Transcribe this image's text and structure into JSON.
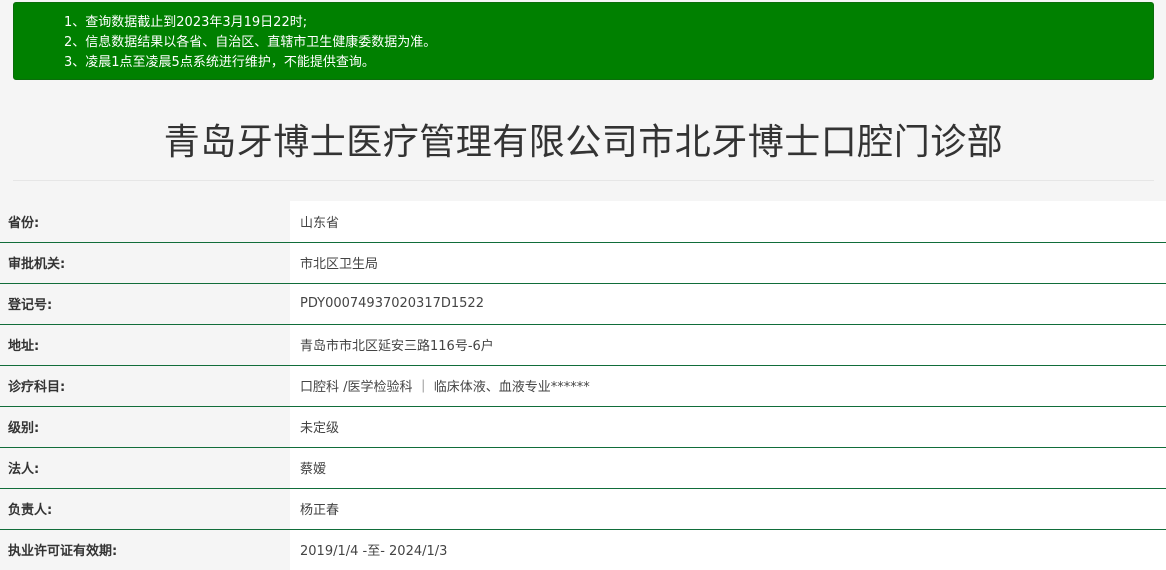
{
  "notice": {
    "lines": [
      "1、查询数据截止到2023年3月19日22时;",
      "2、信息数据结果以各省、自治区、直辖市卫生健康委数据为准。",
      "3、凌晨1点至凌晨5点系统进行维护，不能提供查询。"
    ],
    "background_color": "#008000"
  },
  "page_title": "青岛牙博士医疗管理有限公司市北牙博士口腔门诊部",
  "info": {
    "rows": [
      {
        "label": "省份:",
        "value": "山东省"
      },
      {
        "label": "审批机关:",
        "value": "市北区卫生局"
      },
      {
        "label": "登记号:",
        "value": "PDY00074937020317D1522"
      },
      {
        "label": "地址:",
        "value": "青岛市市北区延安三路116号-6户"
      },
      {
        "label": "诊疗科目:",
        "value": "口腔科 /医学检验科 ｜ 临床体液、血液专业******"
      },
      {
        "label": "级别:",
        "value": "未定级"
      },
      {
        "label": "法人:",
        "value": "蔡嫒"
      },
      {
        "label": "负责人:",
        "value": "杨正春"
      },
      {
        "label": "执业许可证有效期:",
        "value": "2019/1/4 -至- 2024/1/3"
      }
    ],
    "border_color": "#116d3a"
  }
}
